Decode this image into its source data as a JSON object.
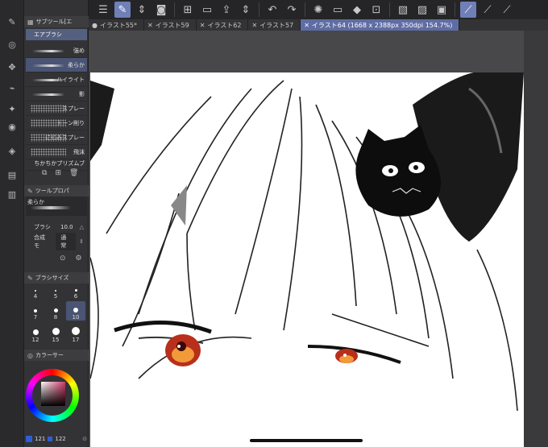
{
  "toolbar": {
    "icons": [
      "menu-icon",
      "pen-icon",
      "updown-icon",
      "layer-icon",
      "new-icon",
      "open-icon",
      "save-icon",
      "undo-icon",
      "redo-icon",
      "loading-icon",
      "clear-icon",
      "fill-icon",
      "transform-icon",
      "brush-a-icon",
      "brush-b-icon",
      "brush-c-icon"
    ]
  },
  "tabs": [
    {
      "label": "イラスト55*",
      "active": false
    },
    {
      "label": "イラスト59",
      "active": false
    },
    {
      "label": "イラスト62",
      "active": false
    },
    {
      "label": "イラスト57",
      "active": false
    },
    {
      "label": "イラスト64 (1668 x 2388px 350dpi 154.7%)",
      "active": true
    }
  ],
  "subtool": {
    "header": "サブツール[エ",
    "active_group": "エアブラシ",
    "brushes": [
      {
        "label": "強め",
        "selected": false
      },
      {
        "label": "柔らか",
        "selected": true
      },
      {
        "label": "ハイライト",
        "selected": false
      },
      {
        "label": "影",
        "selected": false
      },
      {
        "label": "スプレー",
        "selected": false
      },
      {
        "label": "トーン削り",
        "selected": false
      },
      {
        "label": "にじみスプレー",
        "selected": false
      },
      {
        "label": "飛沫",
        "selected": false
      },
      {
        "label": "ちかちかプリズムブ",
        "selected": false
      }
    ]
  },
  "toolprop": {
    "header": "ツールプロパ",
    "current": "柔らか",
    "size_label": "ブラシ",
    "size_value": "10.0",
    "blend_label": "合成モ",
    "blend_value": "通常"
  },
  "brushsize": {
    "header": "ブラシサイズ",
    "sizes": [
      "4",
      "5",
      "6",
      "7",
      "8",
      "10",
      "12",
      "15",
      "17"
    ],
    "selected": "10"
  },
  "color": {
    "header": "カラーサー",
    "value1": "121",
    "value2": "122"
  }
}
